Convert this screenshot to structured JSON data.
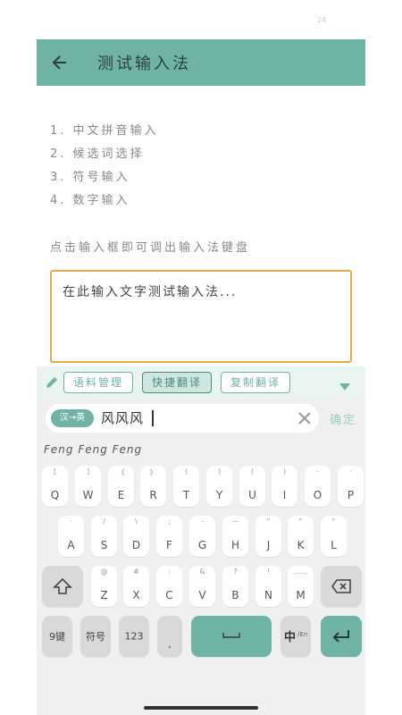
{
  "status": {
    "indicator": "24"
  },
  "appbar": {
    "title": "测试输入法",
    "back_icon": "arrow-left-icon"
  },
  "features": [
    "1. 中文拼音输入",
    "2. 候选词选择",
    "3. 符号输入",
    "4. 数字输入"
  ],
  "hint": "点击输入框即可调出输入法键盘",
  "textbox": {
    "placeholder": "在此输入文字测试输入法..."
  },
  "toolbar": {
    "buttons": [
      "语料管理",
      "快捷翻译",
      "复制翻译"
    ],
    "active": "快捷翻译"
  },
  "translate": {
    "badge": "汉→英",
    "text": "风风风",
    "confirm": "确定"
  },
  "candidate": "Feng Feng Feng",
  "rows": {
    "row1": [
      {
        "sym": "[",
        "key": "Q"
      },
      {
        "sym": "]",
        "key": "W"
      },
      {
        "sym": "《",
        "key": "E"
      },
      {
        "sym": "》",
        "key": "R"
      },
      {
        "sym": "(",
        "key": "T"
      },
      {
        "sym": ")",
        "key": "Y"
      },
      {
        "sym": "(",
        "key": "U"
      },
      {
        "sym": ")",
        "key": "I"
      },
      {
        "sym": "-",
        "key": "O"
      },
      {
        "sym": "·",
        "key": "P"
      }
    ],
    "row2": [
      {
        "sym": "·",
        "key": "A"
      },
      {
        "sym": "/",
        "key": "S"
      },
      {
        "sym": "\\",
        "key": "D"
      },
      {
        "sym": ";",
        "key": "F"
      },
      {
        "sym": "-",
        "key": "G"
      },
      {
        "sym": "—",
        "key": "H"
      },
      {
        "sym": "\"",
        "key": "J"
      },
      {
        "sym": "\"",
        "key": "K"
      },
      {
        "sym": "\"",
        "key": "L"
      }
    ],
    "row3": [
      {
        "sym": "@",
        "key": "Z"
      },
      {
        "sym": "#",
        "key": "X"
      },
      {
        "sym": ":",
        "key": "C"
      },
      {
        "sym": "&",
        "key": "V"
      },
      {
        "sym": "?",
        "key": "B"
      },
      {
        "sym": "!",
        "key": "N"
      },
      {
        "sym": "……",
        "key": "M"
      }
    ]
  },
  "bottom": {
    "key9": "9键",
    "symbols": "符号",
    "num": "123",
    "comma": ",",
    "lang_main": "中",
    "lang_sub": "/En"
  },
  "colors": {
    "accent": "#6fb3a7",
    "border": "#e8a849"
  }
}
